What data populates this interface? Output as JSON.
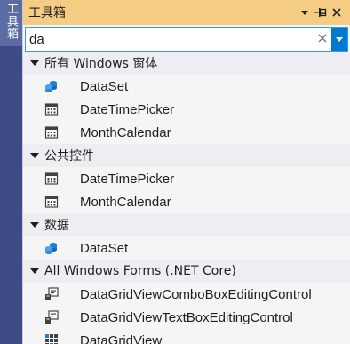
{
  "side_tab": {
    "label": "工具箱"
  },
  "window": {
    "title": "工具箱",
    "buttons": {
      "menu": "▼",
      "pin": "⊣",
      "close": "✕"
    }
  },
  "search": {
    "value": "da",
    "clear": "✕"
  },
  "groups": [
    {
      "label": "所有 Windows 窗体",
      "items": [
        {
          "label": "DataSet",
          "icon": "dataset-icon"
        },
        {
          "label": "DateTimePicker",
          "icon": "calendar-icon"
        },
        {
          "label": "MonthCalendar",
          "icon": "calendar-icon"
        }
      ]
    },
    {
      "label": "公共控件",
      "items": [
        {
          "label": "DateTimePicker",
          "icon": "calendar-icon"
        },
        {
          "label": "MonthCalendar",
          "icon": "calendar-icon"
        }
      ]
    },
    {
      "label": "数据",
      "items": [
        {
          "label": "DataSet",
          "icon": "dataset-icon"
        }
      ]
    },
    {
      "label": "All Windows Forms (.NET Core)",
      "items": [
        {
          "label": "DataGridViewComboBoxEditingControl",
          "icon": "editing-control-icon"
        },
        {
          "label": "DataGridViewTextBoxEditingControl",
          "icon": "editing-control-icon"
        },
        {
          "label": "DataGridView",
          "icon": "grid-icon"
        }
      ]
    }
  ],
  "colors": {
    "title_bar": "#f5cc84",
    "side_strip": "#3d4c86",
    "accent": "#007acc",
    "icon_blue": "#1f7fd4"
  }
}
